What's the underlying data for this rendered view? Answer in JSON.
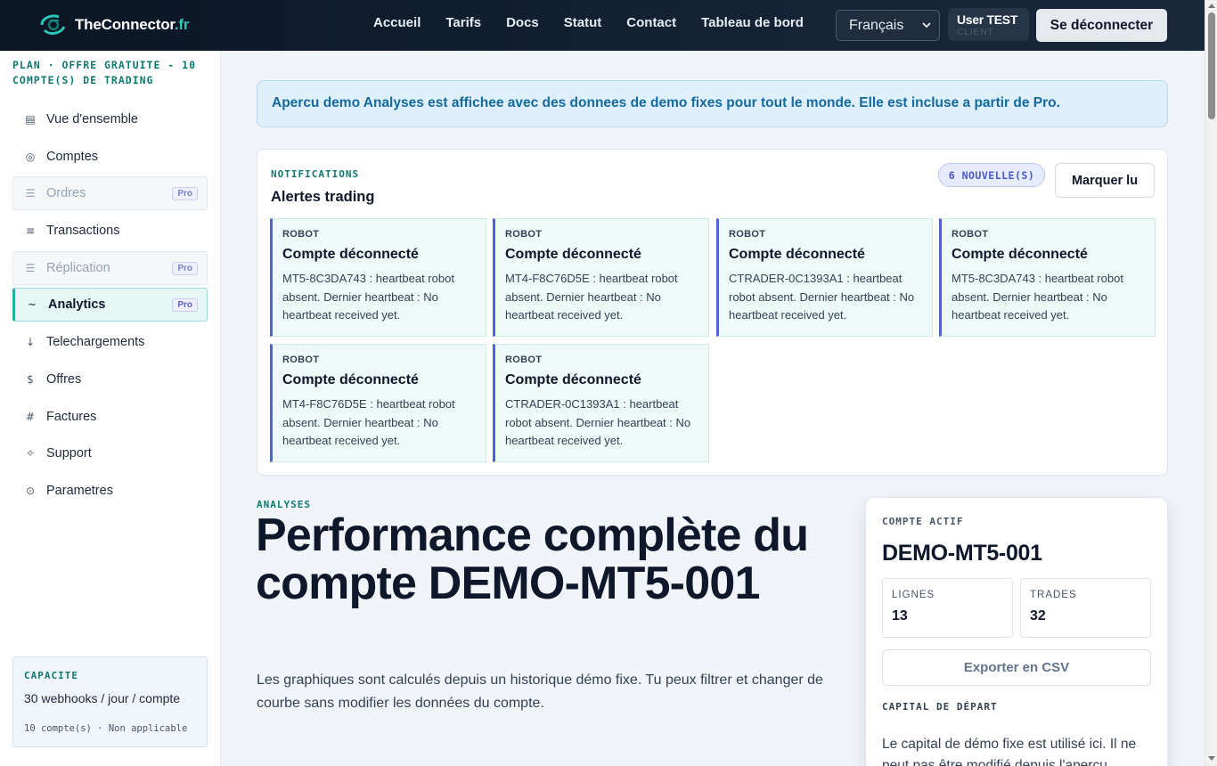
{
  "brand": {
    "name": "TheConnector",
    "tld": ".fr"
  },
  "nav": {
    "items": [
      "Accueil",
      "Tarifs",
      "Docs",
      "Statut",
      "Contact",
      "Tableau de bord"
    ],
    "language": "Français",
    "user_name": "User TEST",
    "user_role": "CLIENT",
    "logout_label": "Se déconnecter"
  },
  "sidebar": {
    "plan": "PLAN · OFFRE GRATUITE - 10 COMPTE(S) DE TRADING",
    "items": [
      {
        "label": "Vue d'ensemble",
        "icon": "grid-icon",
        "glyph": "▤",
        "state": "normal"
      },
      {
        "label": "Comptes",
        "icon": "accounts-icon",
        "glyph": "◎",
        "state": "normal"
      },
      {
        "label": "Ordres",
        "icon": "orders-icon",
        "glyph": "☰",
        "state": "locked",
        "badge": "Pro"
      },
      {
        "label": "Transactions",
        "icon": "transactions-icon",
        "glyph": "≡",
        "state": "normal"
      },
      {
        "label": "Réplication",
        "icon": "replication-icon",
        "glyph": "☰",
        "state": "locked",
        "badge": "Pro"
      },
      {
        "label": "Analytics",
        "icon": "analytics-icon",
        "glyph": "~",
        "state": "active",
        "badge": "Pro"
      },
      {
        "label": "Telechargements",
        "icon": "download-icon",
        "glyph": "↓",
        "state": "normal"
      },
      {
        "label": "Offres",
        "icon": "dollar-icon",
        "glyph": "$",
        "state": "normal"
      },
      {
        "label": "Factures",
        "icon": "hash-icon",
        "glyph": "#",
        "state": "normal"
      },
      {
        "label": "Support",
        "icon": "support-icon",
        "glyph": "✧",
        "state": "normal"
      },
      {
        "label": "Parametres",
        "icon": "settings-icon",
        "glyph": "⊙",
        "state": "normal"
      }
    ],
    "capacity": {
      "title": "CAPACITE",
      "line": "30 webhooks / jour / compte",
      "meta": "10 compte(s) · Non applicable"
    }
  },
  "banner": "Apercu demo Analyses est affichee avec des donnees de demo fixes pour tout le monde. Elle est incluse a partir de Pro.",
  "notifications": {
    "kicker": "NOTIFICATIONS",
    "title": "Alertes trading",
    "badge": "6 NOUVELLE(S)",
    "mark_read": "Marquer lu",
    "alerts": [
      {
        "tag": "ROBOT",
        "title": "Compte déconnecté",
        "body": "MT5-8C3DA743 : heartbeat robot absent. Dernier heartbeat : No heartbeat received yet."
      },
      {
        "tag": "ROBOT",
        "title": "Compte déconnecté",
        "body": "MT4-F8C76D5E : heartbeat robot absent. Dernier heartbeat : No heartbeat received yet."
      },
      {
        "tag": "ROBOT",
        "title": "Compte déconnecté",
        "body": "CTRADER-0C1393A1 : heartbeat robot absent. Dernier heartbeat : No heartbeat received yet."
      },
      {
        "tag": "ROBOT",
        "title": "Compte déconnecté",
        "body": "MT5-8C3DA743 : heartbeat robot absent. Dernier heartbeat : No heartbeat received yet."
      },
      {
        "tag": "ROBOT",
        "title": "Compte déconnecté",
        "body": "MT4-F8C76D5E : heartbeat robot absent. Dernier heartbeat : No heartbeat received yet."
      },
      {
        "tag": "ROBOT",
        "title": "Compte déconnecté",
        "body": "CTRADER-0C1393A1 : heartbeat robot absent. Dernier heartbeat : No heartbeat received yet."
      }
    ]
  },
  "analytics": {
    "kicker": "ANALYSES",
    "title": "Performance complète du compte DEMO-MT5-001",
    "subtitle": "Les graphiques sont calculés depuis un historique démo fixe. Tu peux filtrer et changer de courbe sans modifier les données du compte."
  },
  "account": {
    "kicker": "COMPTE ACTIF",
    "id": "DEMO-MT5-001",
    "lines_label": "LIGNES",
    "lines_value": "13",
    "trades_label": "TRADES",
    "trades_value": "32",
    "export_label": "Exporter en CSV",
    "capital_kicker": "CAPITAL DE DÉPART",
    "capital_text": "Le capital de démo fixe est utilisé ici. Il ne peut pas être modifié depuis l'aperçu."
  },
  "colors": {
    "accent": "#20b2a4",
    "brand_tld": "#2bc4b6",
    "pro_badge": "#5b5fc7",
    "alert_border": "#4f63d2",
    "banner_text": "#136a9e"
  }
}
